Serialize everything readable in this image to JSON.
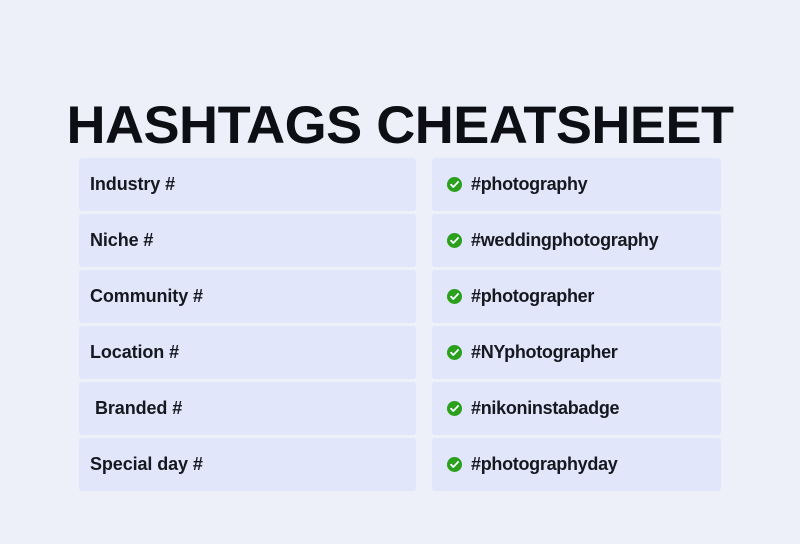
{
  "page": {
    "title": "HASHTAGS CHEATSHEET",
    "background_color": "#edf0f9",
    "row_background_color": "#e2e6fb",
    "text_color": "#16181f",
    "accent_color": "#2aa01e"
  },
  "rows": [
    {
      "category": "Industry #",
      "icon": "check-circle-icon",
      "hashtag": "#photography"
    },
    {
      "category": "Niche #",
      "icon": "check-circle-icon",
      "hashtag": "#weddingphotography"
    },
    {
      "category": "Community #",
      "icon": "check-circle-icon",
      "hashtag": "#photographer"
    },
    {
      "category": "Location #",
      "icon": "check-circle-icon",
      "hashtag": "#NYphotographer"
    },
    {
      "category": "Branded #",
      "icon": "check-circle-icon",
      "hashtag": "#nikoninstabadge"
    },
    {
      "category": "Special day #",
      "icon": "check-circle-icon",
      "hashtag": "#photographyday"
    }
  ]
}
